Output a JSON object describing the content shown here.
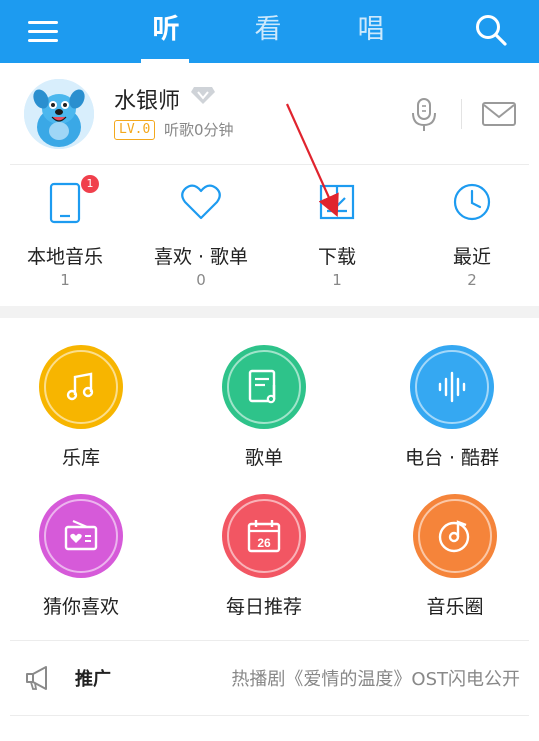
{
  "nav": {
    "tabs": [
      {
        "label": "听"
      },
      {
        "label": "看"
      },
      {
        "label": "唱"
      }
    ],
    "menu_icon": "menu-icon",
    "search_icon": "search-icon",
    "background": "#1d9bf0"
  },
  "profile": {
    "username": "水银师",
    "level": "LV.0",
    "listen_time": "听歌0分钟",
    "vip_icon": "diamond-icon",
    "mic_icon": "microphone-icon",
    "mail_icon": "mail-icon"
  },
  "quick_access": [
    {
      "label": "本地音乐",
      "count": "1",
      "icon": "phone-icon",
      "badge": "1"
    },
    {
      "label": "喜欢 · 歌单",
      "count": "0",
      "icon": "heart-icon"
    },
    {
      "label": "下载",
      "count": "1",
      "icon": "download-icon"
    },
    {
      "label": "最近",
      "count": "2",
      "icon": "clock-icon"
    }
  ],
  "grid": [
    {
      "label": "乐库",
      "icon": "music-note-icon",
      "color": "#f7b500"
    },
    {
      "label": "歌单",
      "icon": "playlist-icon",
      "color": "#2ec38a"
    },
    {
      "label": "电台 · 酷群",
      "icon": "soundwave-icon",
      "color": "#35a8f2"
    },
    {
      "label": "猜你喜欢",
      "icon": "radio-icon",
      "color": "#d65ad9"
    },
    {
      "label": "每日推荐",
      "icon": "calendar-icon",
      "color": "#f25663",
      "date": "26"
    },
    {
      "label": "音乐圈",
      "icon": "disc-icon",
      "color": "#f5843a"
    }
  ],
  "promo": {
    "title": "推广",
    "text": "热播剧《爱情的温度》OST闪电公开",
    "icon": "megaphone-icon"
  },
  "accent": "#1d9bf0"
}
